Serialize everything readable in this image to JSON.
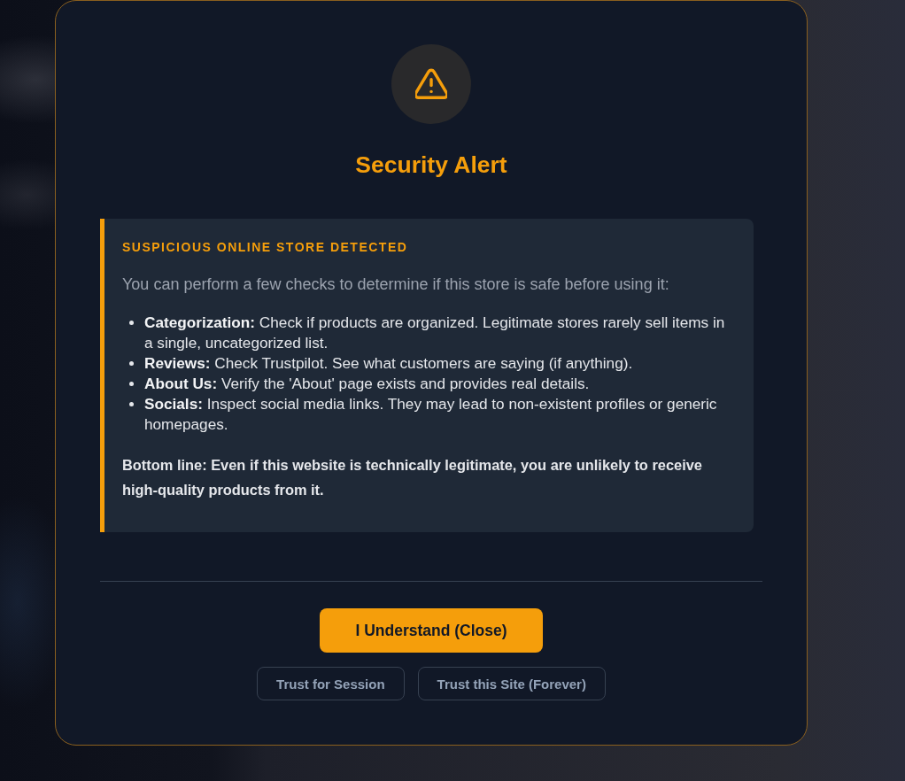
{
  "dialog": {
    "title": "Security Alert",
    "notice": {
      "heading": "SUSPICIOUS ONLINE STORE DETECTED",
      "intro": "You can perform a few checks to determine if this store is safe before using it:",
      "checks": [
        "**Categorization:** Check if products are organized. Legitimate stores rarely sell items in a single, uncategorized list.",
        "**Reviews:** Check Trustpilot. See what customers are saying (if anything).",
        "**About Us:** Verify the 'About' page exists and provides real details.",
        "**Socials:** Inspect social media links. They may lead to non-existent profiles or generic homepages."
      ],
      "bottom_line": "Bottom line: Even if this website is technically legitimate, you are unlikely to receive high-quality products from it."
    },
    "buttons": [
      {
        "label": "I Understand (Close)",
        "kind": "primary"
      },
      {
        "label": "Trust for Session",
        "kind": "secondary"
      },
      {
        "label": "Trust this Site (Forever)",
        "kind": "secondary"
      }
    ]
  }
}
